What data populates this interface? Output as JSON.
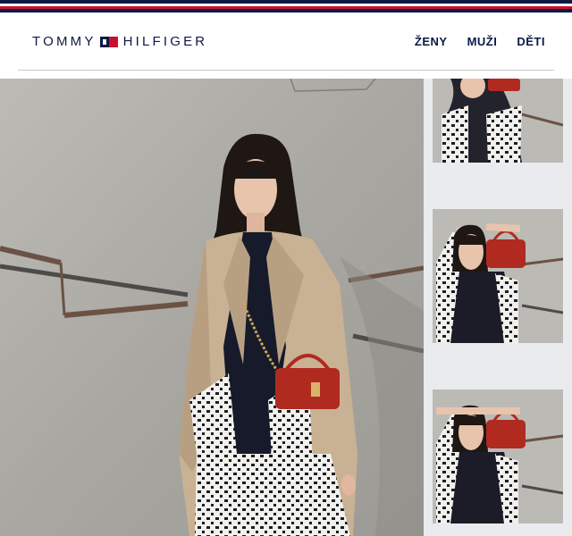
{
  "brand": {
    "word1": "TOMMY",
    "word2": "HILFIGER",
    "colors": {
      "navy": "#0b1a45",
      "red": "#c8102e"
    }
  },
  "nav": {
    "items": [
      "ŽENY",
      "MUŽI",
      "DĚTI"
    ]
  },
  "icons": [
    "flag-logo-icon"
  ]
}
